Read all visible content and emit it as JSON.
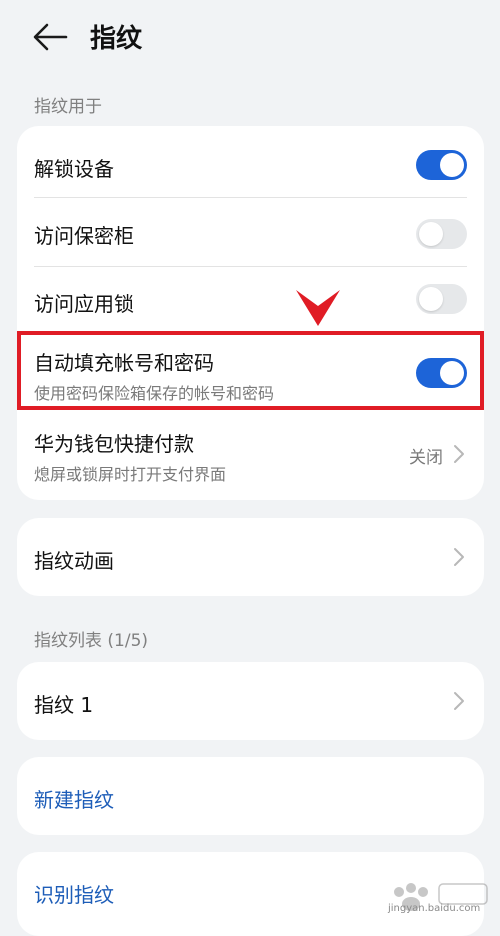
{
  "header": {
    "title": "指纹"
  },
  "section_use": {
    "label": "指纹用于"
  },
  "use_items": [
    {
      "title": "解锁设备",
      "toggle": "on"
    },
    {
      "title": "访问保密柜",
      "toggle": "off"
    },
    {
      "title": "访问应用锁",
      "toggle": "off"
    },
    {
      "title": "自动填充帐号和密码",
      "subtitle": "使用密码保险箱保存的帐号和密码",
      "toggle": "on"
    },
    {
      "title": "华为钱包快捷付款",
      "subtitle": "熄屏或锁屏时打开支付界面",
      "value": "关闭"
    }
  ],
  "animation_item": {
    "title": "指纹动画"
  },
  "section_list": {
    "label": "指纹列表 (1/5)"
  },
  "fingerprint_items": [
    {
      "title": "指纹 1"
    }
  ],
  "actions": {
    "new_fingerprint": "新建指纹",
    "identify_fingerprint": "识别指纹"
  },
  "watermark": {
    "text": "jingyan.baidu.com"
  },
  "colors": {
    "accent": "#1d64d8",
    "highlight": "#e01c25",
    "background": "#f1f3f5",
    "link": "#1d5db8"
  },
  "icons": {
    "back": "arrow-left-icon",
    "chevron": "chevron-right-icon",
    "annotation": "red-check-arrow-icon",
    "watermark": "baidu-paw-icon"
  }
}
